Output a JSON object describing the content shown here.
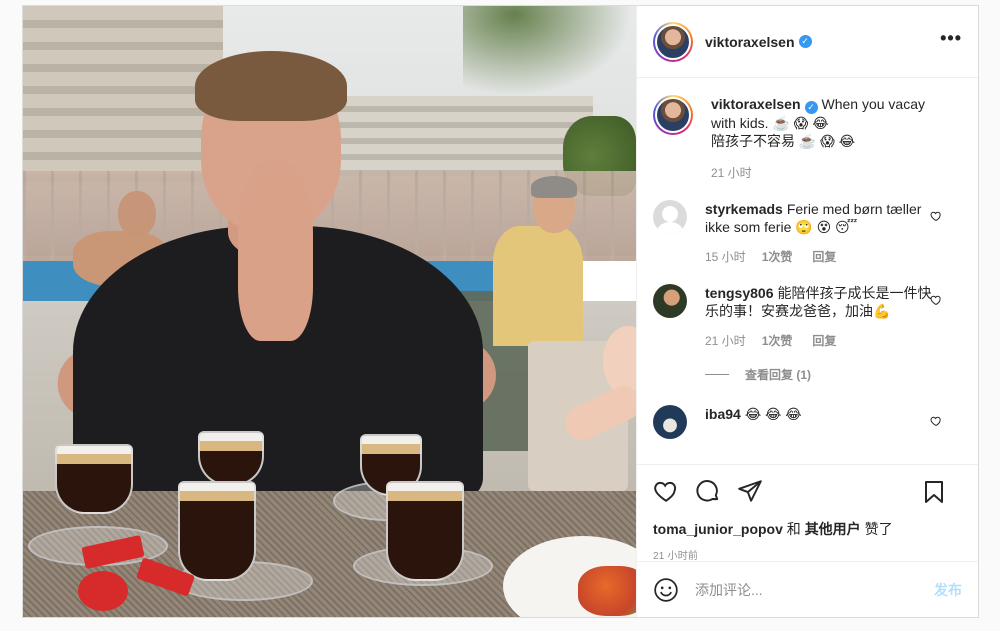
{
  "post": {
    "author": "viktoraxelsen",
    "verified_icon": "verified-badge-icon",
    "more_icon": "more-options-icon",
    "caption": {
      "username": "viktoraxelsen",
      "line1": "When you vacay",
      "line2": "with kids. ☕️ 😱 😂",
      "line3": "陪孩子不容易 ☕️ 😱 😂",
      "time": "21 小时"
    },
    "comments": [
      {
        "username": "styrkemads",
        "text": "Ferie med børn tæller ikke som ferie 🙄 😵 😴",
        "time": "15 小时",
        "likes": "1次赞",
        "reply": "回复"
      },
      {
        "username": "tengsy806",
        "text": "能陪伴孩子成长是一件快乐的事！安赛龙爸爸，加油💪",
        "time": "21 小时",
        "likes": "1次赞",
        "reply": "回复",
        "view_replies": "查看回复 (1)"
      },
      {
        "username": "iba94",
        "text": "😂 😂 😂"
      }
    ],
    "liked_by": {
      "user": "toma_junior_popov",
      "middle": " 和 ",
      "others": "其他用户",
      "suffix": " 赞了"
    },
    "posted_time": "21 小时前",
    "add_comment": {
      "placeholder": "添加评论...",
      "post_label": "发布",
      "emoji_icon": "emoji-smile-icon"
    },
    "colors": {
      "accent": "#3897f0",
      "post_disabled": "#b2dffc",
      "meta_text": "#8e8e8e"
    }
  }
}
